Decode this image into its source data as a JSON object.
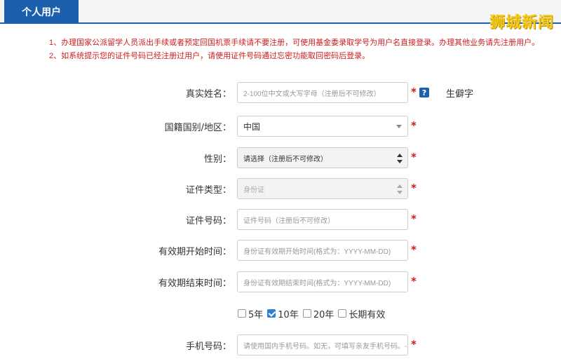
{
  "header": {
    "tab_label": "个人用户",
    "watermark": "狮城新闻"
  },
  "notices": [
    "1、办理国家公派留学人员派出手续或者预定回国机票手续请不要注册，可使用基金委录取学号为用户名直接登录。办理其他业务请先注册用户。",
    "2、如系统提示您的证件号码已经注册过用户，请使用证件号码通过忘密功能取回密码后登录。"
  ],
  "form": {
    "real_name": {
      "label": "真实姓名：",
      "placeholder": "2-100位中文或大写字母（注册后不可修改）"
    },
    "help_icon": "?",
    "rare_char": "生僻字",
    "nationality": {
      "label": "国籍国别/地区：",
      "value": "中国"
    },
    "gender": {
      "label": "性别：",
      "value": "请选择（注册后不可修改）"
    },
    "id_type": {
      "label": "证件类型：",
      "value": "身份证"
    },
    "id_number": {
      "label": "证件号码：",
      "placeholder": "证件号码（注册后不可修改）"
    },
    "valid_start": {
      "label": "有效期开始时间：",
      "placeholder": "身份证有效期开始时间(格式为：YYYY-MM-DD)"
    },
    "valid_end": {
      "label": "有效期结束时间：",
      "placeholder": "身份证有效期结束时间(格式为：YYYY-MM-DD)"
    },
    "validity_options": [
      {
        "label": "5年",
        "checked": false
      },
      {
        "label": "10年",
        "checked": true
      },
      {
        "label": "20年",
        "checked": false
      },
      {
        "label": "长期有效",
        "checked": false
      }
    ],
    "phone": {
      "label": "手机号码：",
      "placeholder": "请使用国内手机号码。如无，可填写亲友手机号码。-"
    },
    "required_mark": "*"
  },
  "colors": {
    "brand": "#1b5fad",
    "required": "#d01c1c",
    "checkbox_checked": "#2f7ed8"
  }
}
